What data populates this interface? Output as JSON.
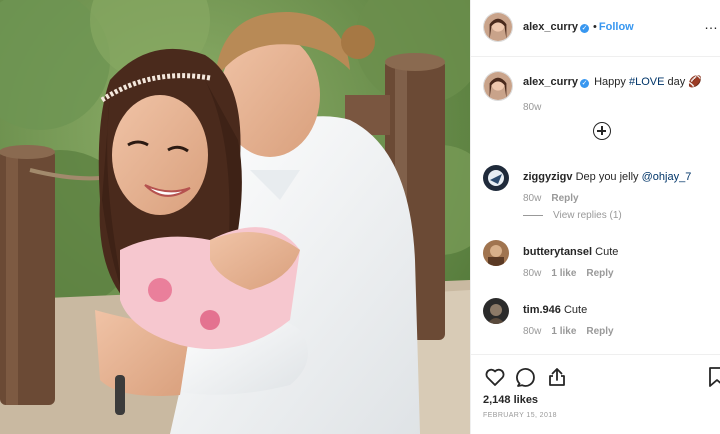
{
  "post": {
    "username": "alex_curry",
    "follow_label": "Follow",
    "separator": "•",
    "verified_glyph": "✓",
    "more_glyph": "…"
  },
  "caption": {
    "username": "alex_curry",
    "text_before": "Happy ",
    "hashtag": "#LOVE",
    "text_after": " day",
    "emoji": "🏈",
    "age": "80w"
  },
  "comments": [
    {
      "username": "ziggyzigv",
      "text": "Dep you jelly ",
      "mention": "@ohjay_7",
      "age": "80w",
      "likes": "",
      "reply_label": "Reply",
      "view_replies": "View replies (1)"
    },
    {
      "username": "butterytansel",
      "text": "Cute",
      "age": "80w",
      "likes": "1 like",
      "reply_label": "Reply"
    },
    {
      "username": "tim.946",
      "text": "Cute",
      "age": "80w",
      "likes": "1 like",
      "reply_label": "Reply"
    }
  ],
  "stats": {
    "likes": "2,148 likes",
    "date": "FEBRUARY 15, 2018"
  },
  "icons": [
    "heart-icon",
    "comment-icon",
    "share-icon",
    "bookmark-icon",
    "add-comment-icon",
    "verified-icon"
  ],
  "colors": {
    "link_blue": "#3897f0",
    "hashtag_blue": "#003569",
    "muted_gray": "#999999",
    "text_dark": "#262626"
  }
}
